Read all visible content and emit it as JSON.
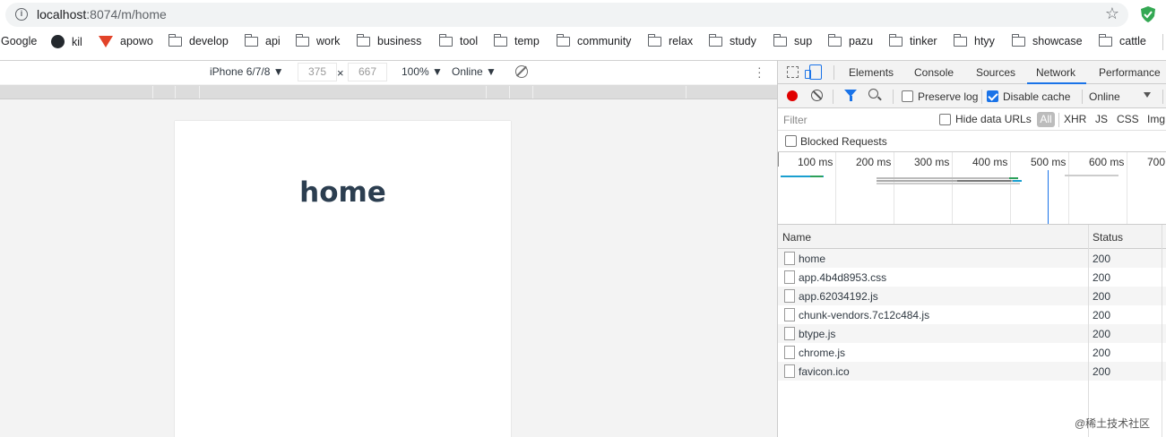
{
  "browser": {
    "url_host": "localhost",
    "url_rest": ":8074/m/home",
    "bookmarks": [
      "Google",
      "kil",
      "apowo",
      "develop",
      "api",
      "work",
      "business",
      "tool",
      "temp",
      "community",
      "relax",
      "study",
      "sup",
      "pazu",
      "tinker",
      "htyy",
      "showcase",
      "cattle"
    ]
  },
  "emulation": {
    "device": "iPhone 6/7/8 ▼",
    "width": "375",
    "times": "×",
    "height": "667",
    "zoom": "100% ▼",
    "network": "Online ▼"
  },
  "page": {
    "heading": "home"
  },
  "devtools": {
    "tabs": [
      "Elements",
      "Console",
      "Sources",
      "Network",
      "Performance"
    ],
    "active_tab": "Network",
    "preserve_log": "Preserve log",
    "disable_cache": "Disable cache",
    "throttling": "Online",
    "filter_placeholder": "Filter",
    "hide_data_urls": "Hide data URLs",
    "type_filters": [
      "All",
      "XHR",
      "JS",
      "CSS",
      "Img"
    ],
    "blocked_requests": "Blocked Requests",
    "timeline_labels": [
      "100 ms",
      "200 ms",
      "300 ms",
      "400 ms",
      "500 ms",
      "600 ms",
      "700"
    ],
    "columns": [
      "Name",
      "Status"
    ],
    "requests": [
      {
        "name": "home",
        "status": "200"
      },
      {
        "name": "app.4b4d8953.css",
        "status": "200"
      },
      {
        "name": "app.62034192.js",
        "status": "200"
      },
      {
        "name": "chunk-vendors.7c12c484.js",
        "status": "200"
      },
      {
        "name": "btype.js",
        "status": "200"
      },
      {
        "name": "chrome.js",
        "status": "200"
      },
      {
        "name": "favicon.ico",
        "status": "200"
      }
    ]
  },
  "watermark": "@稀土技术社区"
}
